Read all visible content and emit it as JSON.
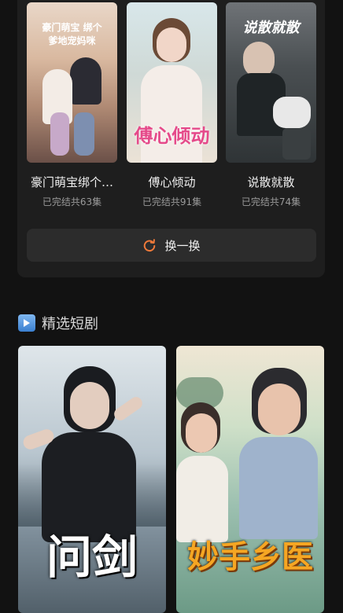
{
  "recommend": {
    "items": [
      {
        "title": "豪门萌宝绑个…",
        "subtitle": "已完结共63集",
        "poster_text": "豪门萌宝 绑个爹地宠妈咪"
      },
      {
        "title": "傅心倾动",
        "subtitle": "已完结共91集",
        "poster_text": "傅心倾动"
      },
      {
        "title": "说散就散",
        "subtitle": "已完结共74集",
        "poster_text": "说散就散"
      }
    ],
    "swap_label": "换一换"
  },
  "featured": {
    "section_title": "精选短剧",
    "cards": [
      {
        "poster_text": "问剑"
      },
      {
        "poster_text": "妙手乡医"
      }
    ]
  },
  "colors": {
    "background": "#121212",
    "panel": "#1e1e1e",
    "button": "#2c2c2c",
    "accent": "#f07a3a"
  },
  "icons": {
    "refresh": "refresh-icon",
    "section": "play-icon"
  }
}
